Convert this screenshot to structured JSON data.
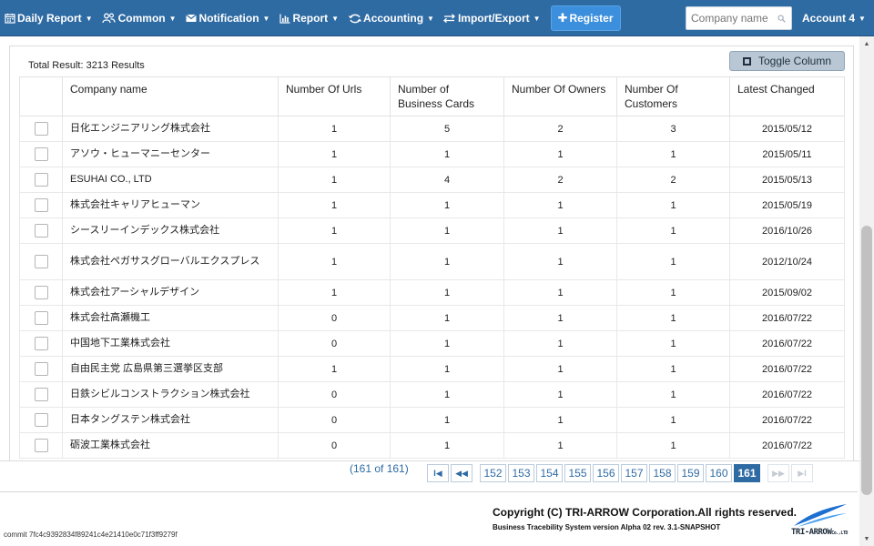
{
  "nav": {
    "items": [
      {
        "label": "Daily Report",
        "icon": "calendar-icon"
      },
      {
        "label": "Common",
        "icon": "users-icon"
      },
      {
        "label": "Notification",
        "icon": "envelope-icon"
      },
      {
        "label": "Report",
        "icon": "bar-chart-icon"
      },
      {
        "label": "Accounting",
        "icon": "exchange-icon"
      },
      {
        "label": "Import/Export",
        "icon": "transfer-icon"
      }
    ],
    "register_label": "Register",
    "search_placeholder": "Company name",
    "account_label": "Account 4"
  },
  "results": {
    "total_text": "Total Result: 3213 Results",
    "toggle_column_label": "Toggle Column"
  },
  "table": {
    "headers": [
      "Company name",
      "Number Of Urls",
      "Number of Business Cards",
      "Number Of Owners",
      "Number Of Customers",
      "Latest Changed"
    ],
    "rows": [
      {
        "name": "日化エンジニアリング株式会社",
        "urls": "1",
        "cards": "5",
        "owners": "2",
        "customers": "3",
        "changed": "2015/05/12"
      },
      {
        "name": "アソウ・ヒューマニーセンター",
        "urls": "1",
        "cards": "1",
        "owners": "1",
        "customers": "1",
        "changed": "2015/05/11"
      },
      {
        "name": "ESUHAI CO., LTD",
        "urls": "1",
        "cards": "4",
        "owners": "2",
        "customers": "2",
        "changed": "2015/05/13"
      },
      {
        "name": "株式会社キャリアヒューマン",
        "urls": "1",
        "cards": "1",
        "owners": "1",
        "customers": "1",
        "changed": "2015/05/19"
      },
      {
        "name": "シースリーインデックス株式会社",
        "urls": "1",
        "cards": "1",
        "owners": "1",
        "customers": "1",
        "changed": "2016/10/26"
      },
      {
        "name": "株式会社ペガサスグローバルエクスプレス",
        "urls": "1",
        "cards": "1",
        "owners": "1",
        "customers": "1",
        "changed": "2012/10/24",
        "tall": true
      },
      {
        "name": "株式会社アーシャルデザイン",
        "urls": "1",
        "cards": "1",
        "owners": "1",
        "customers": "1",
        "changed": "2015/09/02"
      },
      {
        "name": "株式会社高瀬機工",
        "urls": "0",
        "cards": "1",
        "owners": "1",
        "customers": "1",
        "changed": "2016/07/22"
      },
      {
        "name": "中国地下工業株式会社",
        "urls": "0",
        "cards": "1",
        "owners": "1",
        "customers": "1",
        "changed": "2016/07/22"
      },
      {
        "name": "自由民主党 広島県第三選挙区支部",
        "urls": "1",
        "cards": "1",
        "owners": "1",
        "customers": "1",
        "changed": "2016/07/22"
      },
      {
        "name": "日鉄シビルコンストラクション株式会社",
        "urls": "0",
        "cards": "1",
        "owners": "1",
        "customers": "1",
        "changed": "2016/07/22"
      },
      {
        "name": "日本タングステン株式会社",
        "urls": "0",
        "cards": "1",
        "owners": "1",
        "customers": "1",
        "changed": "2016/07/22"
      },
      {
        "name": "砺波工業株式会社",
        "urls": "0",
        "cards": "1",
        "owners": "1",
        "customers": "1",
        "changed": "2016/07/22"
      }
    ]
  },
  "pagination": {
    "info": "(161 of 161)",
    "first": "I◀",
    "prev": "◀◀",
    "pages": [
      "152",
      "153",
      "154",
      "155",
      "156",
      "157",
      "158",
      "159",
      "160",
      "161"
    ],
    "current": "161",
    "next": "▶▶",
    "last": "▶I"
  },
  "footer": {
    "copyright": "Copyright (C) TRI-ARROW Corporation.All rights reserved.",
    "version": "Business Tracebility System version Alpha 02 rev. 3.1-SNAPSHOT",
    "commit": "commit 7fc4c9392834f89241c4e21410e0c71f3ff9279f",
    "logo_text": "TRI-ARROW",
    "logo_suffix": "Co.,LTD"
  },
  "colors": {
    "navbar": "#2f6ba3",
    "register": "#3c8fdc",
    "active_page": "#2f6ba3"
  }
}
